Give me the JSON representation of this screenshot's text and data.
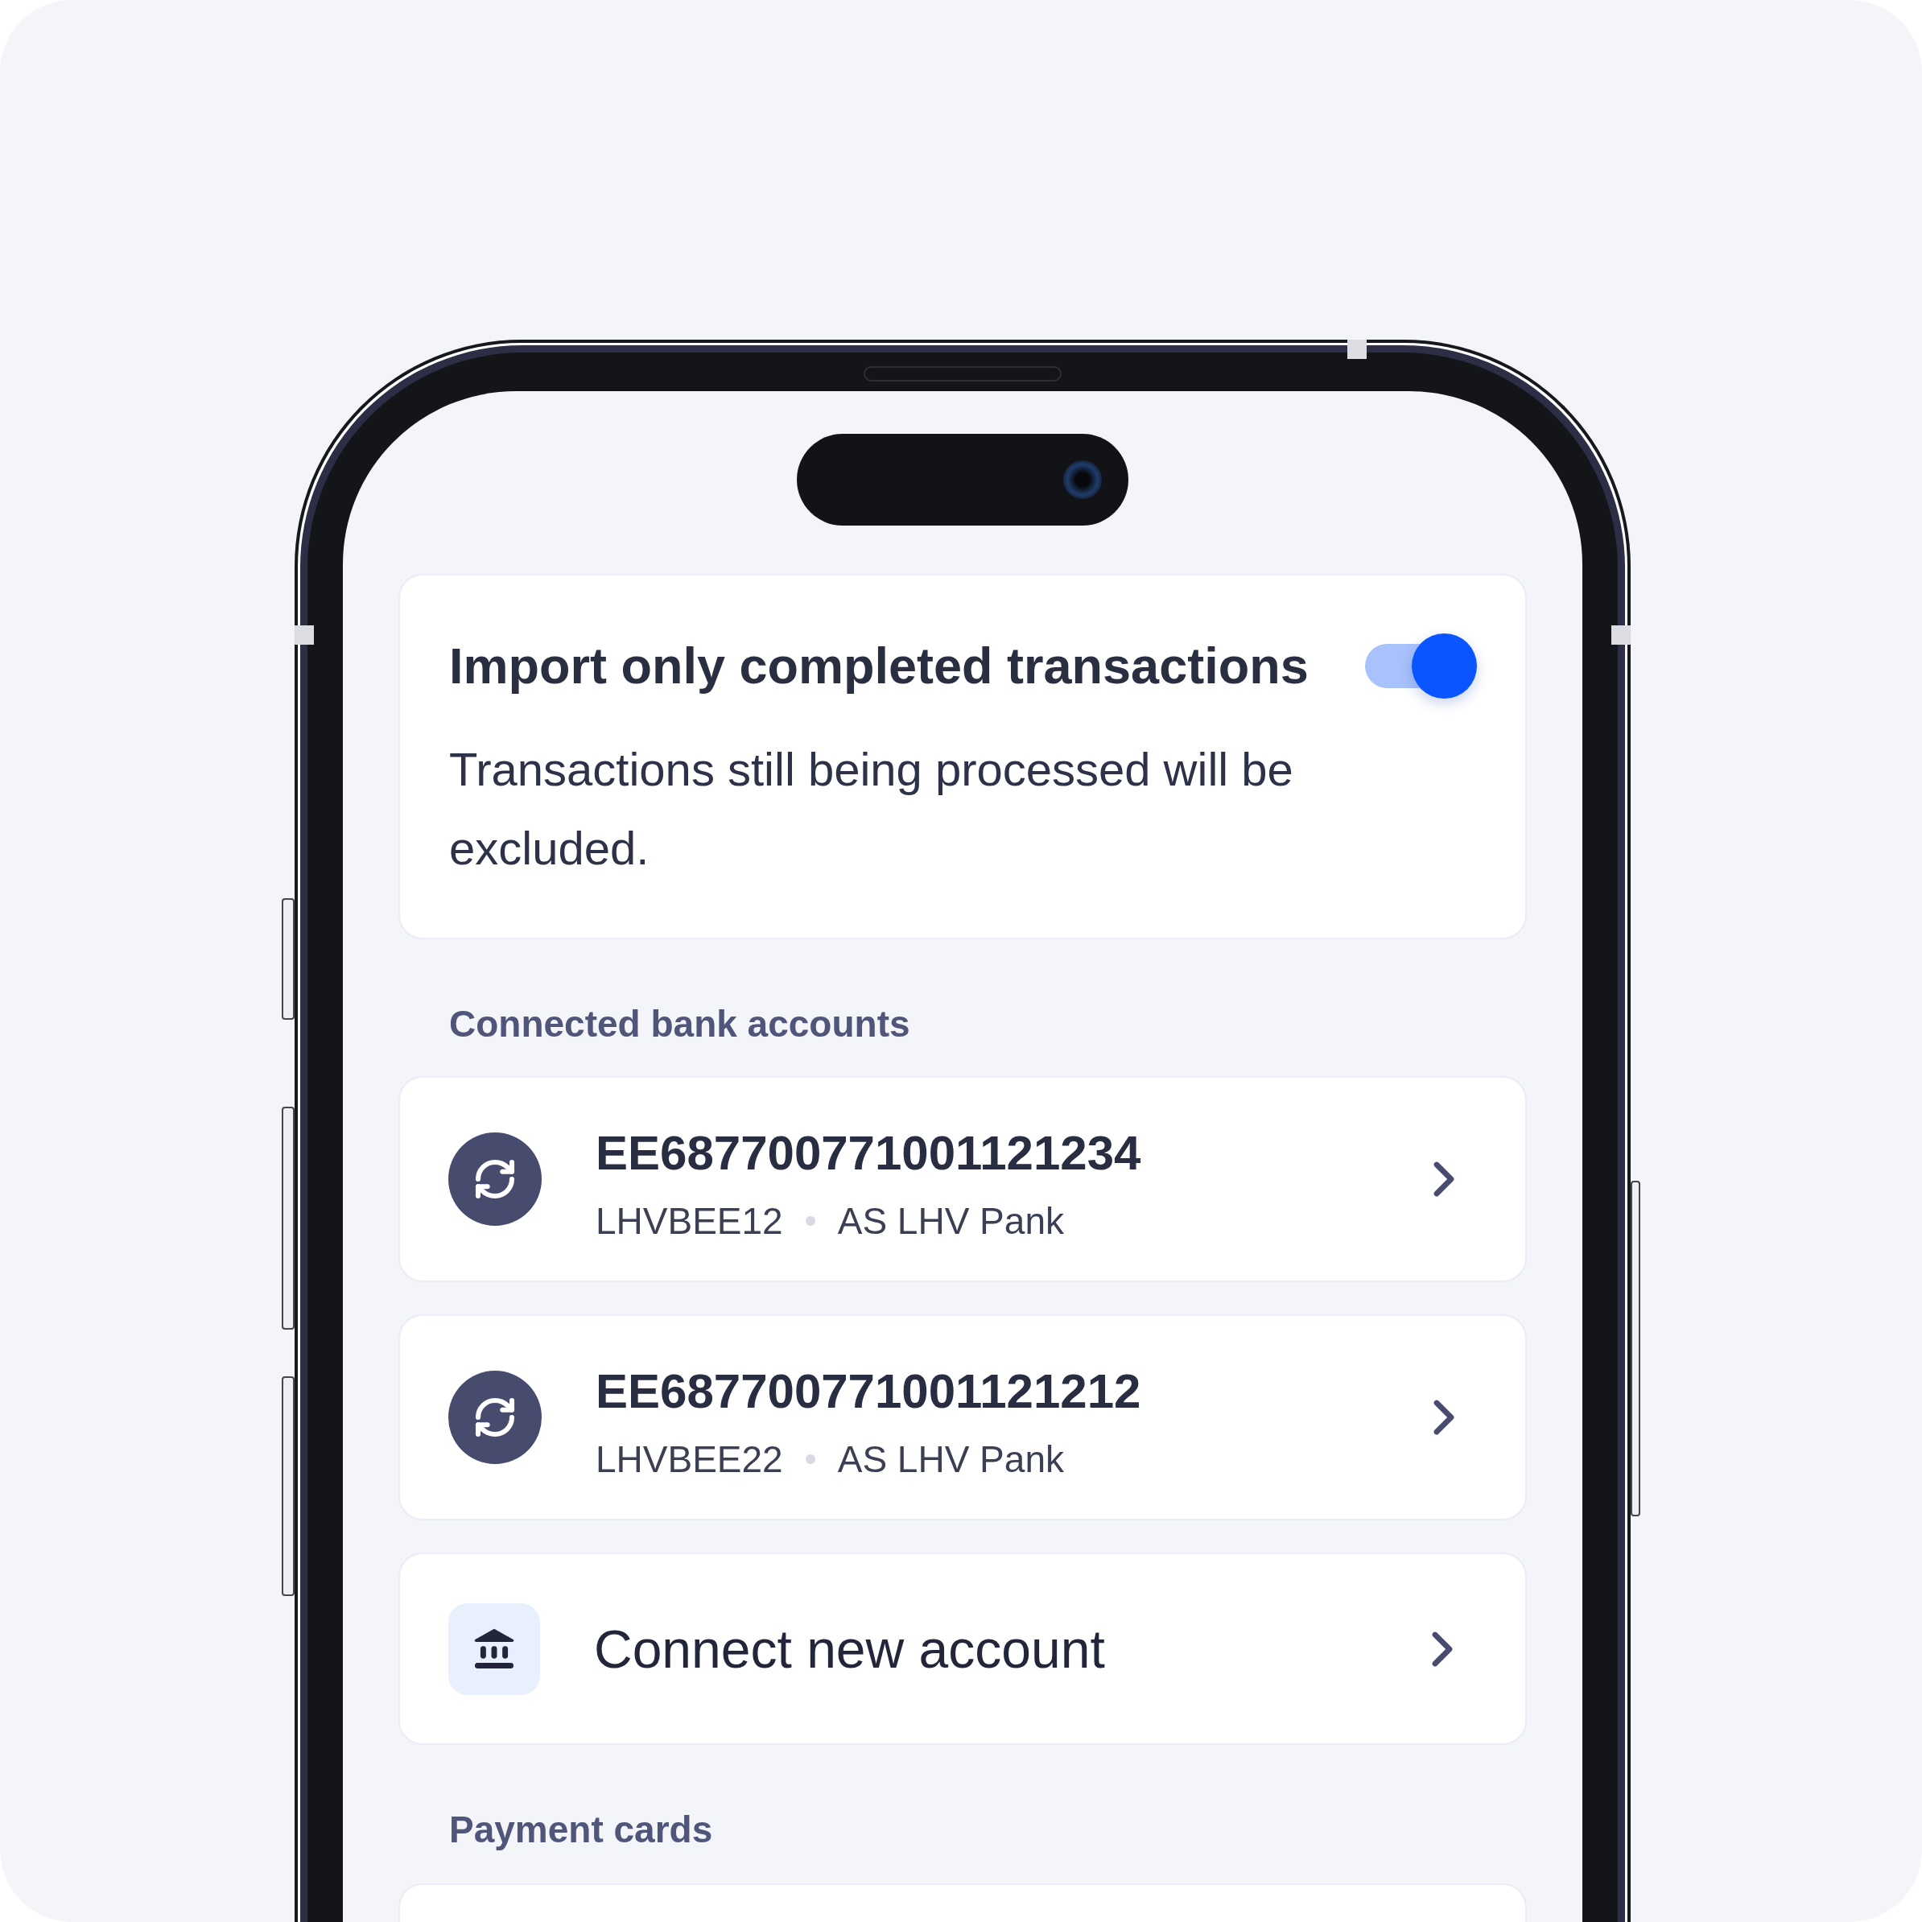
{
  "import_setting": {
    "title": "Import only completed transactions",
    "on": true,
    "description": "Transactions still being processed will be excluded."
  },
  "bank_accounts": {
    "heading": "Connected bank accounts",
    "accounts": [
      {
        "iban": "EE687700771001121234",
        "bic": "LHVBEE12",
        "bank": "AS LHV Pank"
      },
      {
        "iban": "EE687700771001121212",
        "bic": "LHVBEE22",
        "bank": "AS LHV Pank"
      }
    ],
    "connect_action": {
      "label": "Connect new account"
    }
  },
  "payment_cards": {
    "heading": "Payment cards"
  }
}
